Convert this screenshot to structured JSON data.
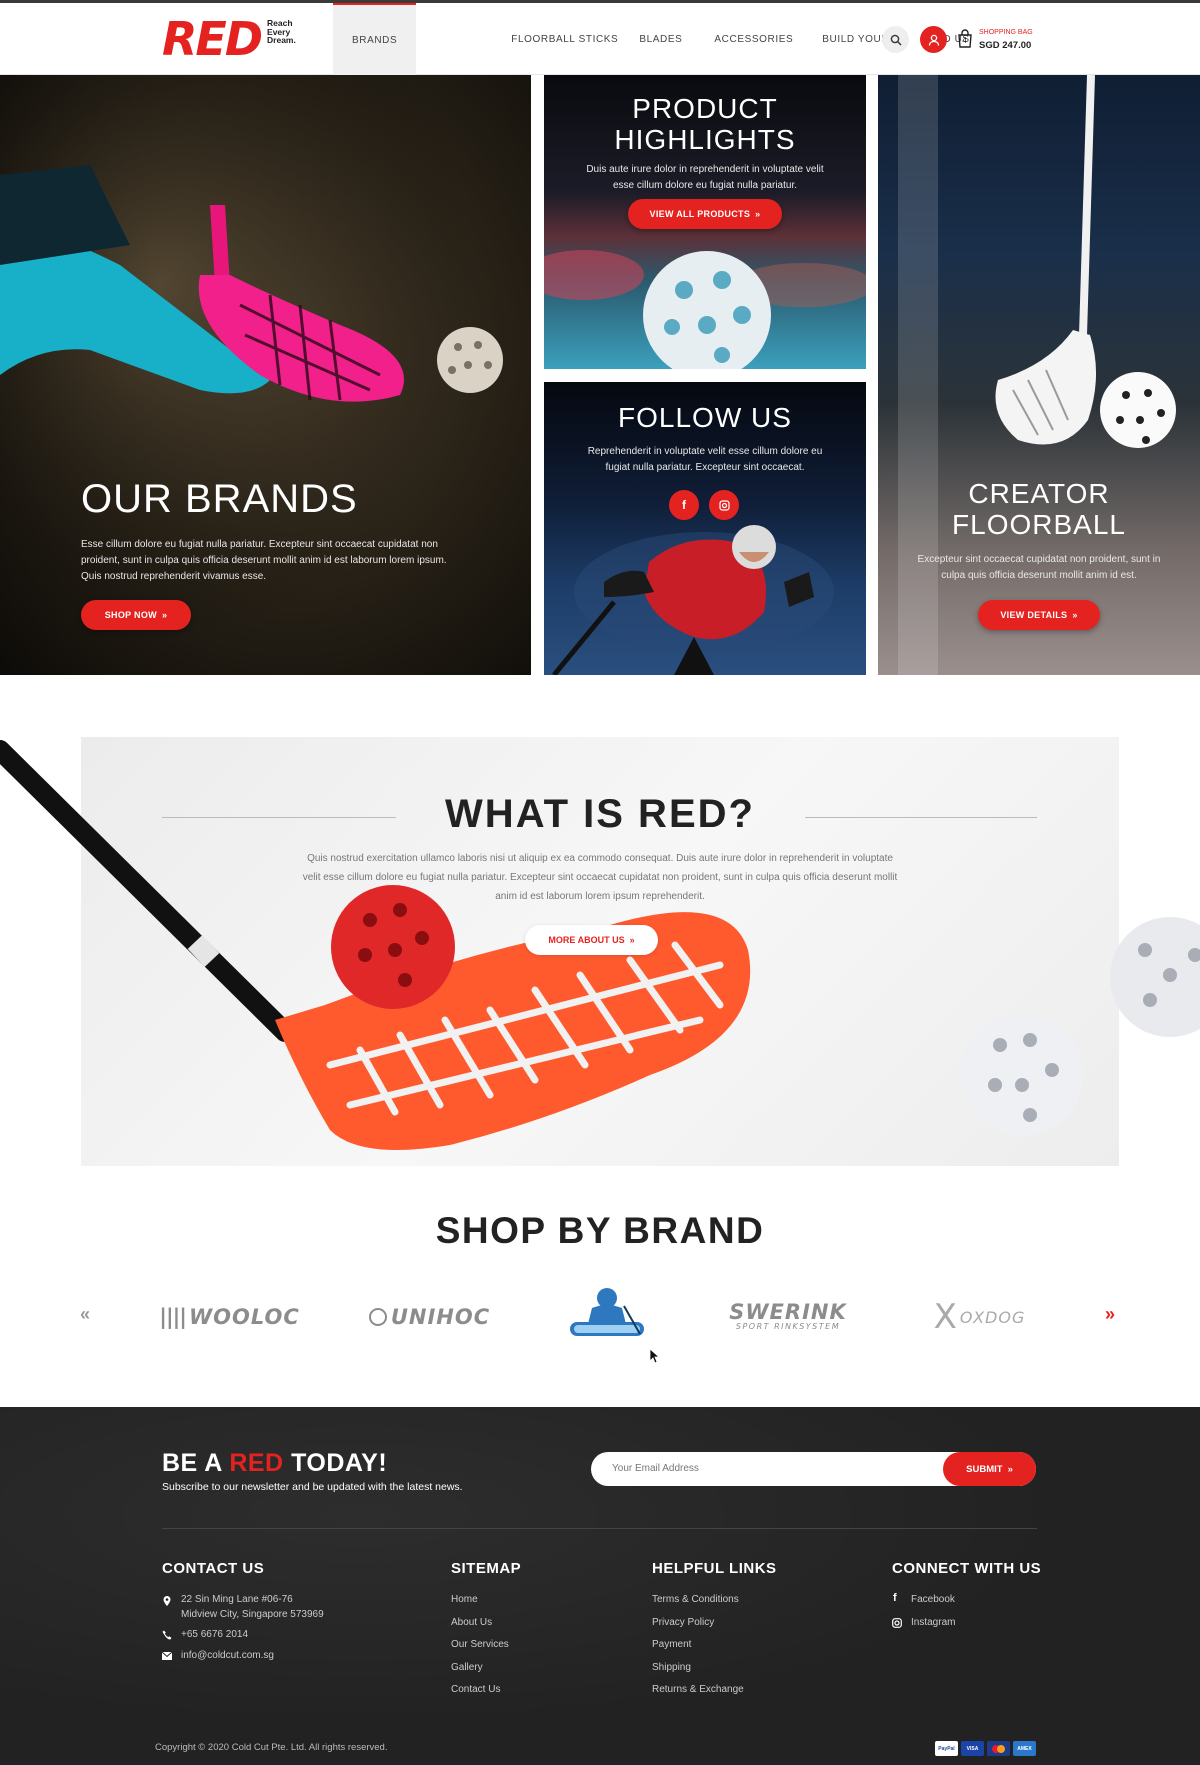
{
  "header": {
    "logo": {
      "word": "RED",
      "tagline": "Reach Every Dream."
    },
    "nav": [
      {
        "label": "BRANDS",
        "active": true
      },
      {
        "label": "FLOORBALL STICKS"
      },
      {
        "label": "BLADES"
      },
      {
        "label": "ACCESSORIES"
      },
      {
        "label": "BUILD YOURS"
      },
      {
        "label": "FIND US"
      }
    ],
    "bag": {
      "label": "SHOPPING BAG",
      "total": "SGD 247.00",
      "count": "4"
    }
  },
  "hero": {
    "brands": {
      "title": "OUR BRANDS",
      "text": "Esse cillum dolore eu fugiat nulla pariatur. Excepteur sint occaecat cupidatat non proident, sunt in culpa quis officia deserunt mollit anim id est laborum lorem ipsum. Quis nostrud reprehenderit vivamus esse.",
      "button": "SHOP NOW"
    },
    "highlights": {
      "title": "PRODUCT HIGHLIGHTS",
      "text": "Duis aute irure dolor in reprehenderit in voluptate velit esse cillum dolore eu fugiat nulla pariatur.",
      "button": "VIEW ALL PRODUCTS"
    },
    "follow": {
      "title": "FOLLOW US",
      "text": "Reprehenderit in voluptate velit esse cillum dolore eu fugiat nulla pariatur. Excepteur sint occaecat."
    },
    "creator": {
      "title": "CREATOR FLOORBALL",
      "text": "Excepteur sint occaecat cupidatat non proident, sunt in culpa quis officia deserunt mollit anim id est.",
      "button": "VIEW DETAILS"
    }
  },
  "about": {
    "title": "WHAT IS RED?",
    "text": "Quis nostrud exercitation ullamco laboris nisi ut aliquip ex ea commodo consequat. Duis aute irure dolor in reprehenderit in voluptate velit esse cillum dolore eu fugiat nulla pariatur. Excepteur sint occaecat cupidatat non proident, sunt in culpa quis officia deserunt mollit anim id est laborum lorem ipsum reprehenderit.",
    "button": "MORE ABOUT US"
  },
  "brands_section": {
    "title": "SHOP BY BRAND",
    "brands": [
      "WOOLOC",
      "UNIHOC",
      "",
      "SWERINK",
      "OXDOG"
    ],
    "swerink_sub": "SPORT RINKSYSTEM"
  },
  "newsletter": {
    "title_pre": "BE A ",
    "title_red": "RED",
    "title_post": " TODAY!",
    "subtitle": "Subscribe to our newsletter and be updated with the latest news.",
    "placeholder": "Your Email Address",
    "submit": "SUBMIT"
  },
  "footer": {
    "contact": {
      "title": "CONTACT US",
      "address1": "22 Sin Ming Lane #06-76",
      "address2": "Midview City, Singapore 573969",
      "phone": "+65 6676 2014",
      "email": "info@coldcut.com.sg"
    },
    "sitemap": {
      "title": "SITEMAP",
      "links": [
        "Home",
        "About Us",
        "Our Services",
        "Gallery",
        "Contact Us"
      ]
    },
    "helpful": {
      "title": "HELPFUL LINKS",
      "links": [
        "Terms & Conditions",
        "Privacy Policy",
        "Payment",
        "Shipping",
        "Returns & Exchange"
      ]
    },
    "connect": {
      "title": "CONNECT WITH US",
      "links": [
        "Facebook",
        "Instagram"
      ]
    },
    "copyright": "Copyright © 2020 Cold Cut Pte. Ltd. All rights reserved.",
    "payments": [
      "PayPal",
      "VISA",
      "",
      "AMEX"
    ]
  },
  "colors": {
    "accent": "#e42320",
    "footer": "#222222"
  }
}
